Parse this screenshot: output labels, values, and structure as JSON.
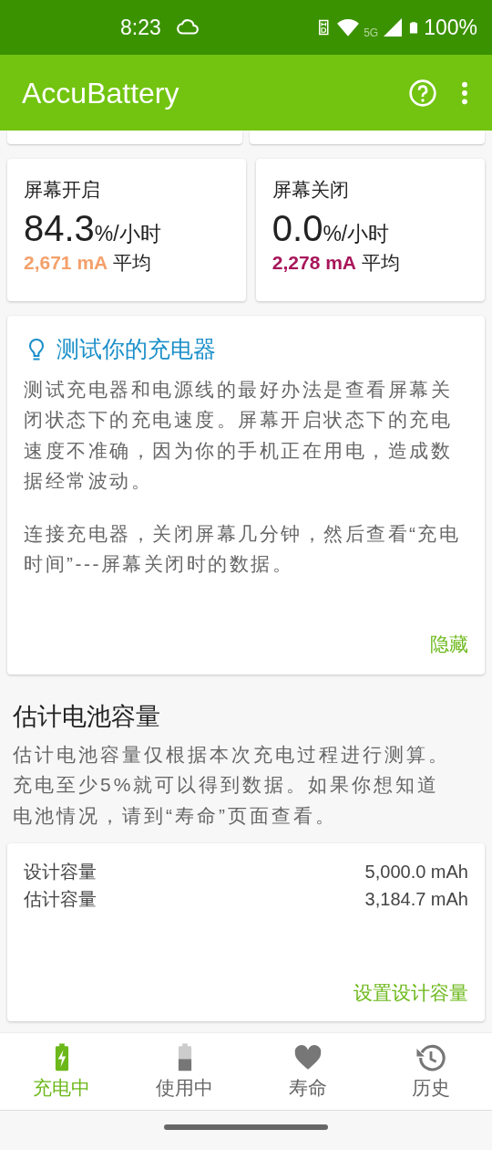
{
  "status_bar": {
    "time": "8:23",
    "network": "5G",
    "battery": "100%"
  },
  "app_bar": {
    "title": "AccuBattery"
  },
  "rate_cards": [
    {
      "title": "屏幕开启",
      "value": "84.3",
      "unit": "%/小时",
      "current": "2,671 mA",
      "suffix": "平均",
      "color": "#f4a06a"
    },
    {
      "title": "屏幕关闭",
      "value": "0.0",
      "unit": "%/小时",
      "current": "2,278 mA",
      "suffix": "平均",
      "color": "#a8165a"
    }
  ],
  "tip_card": {
    "title": "测试你的充电器",
    "paragraphs": [
      "测试充电器和电源线的最好办法是查看屏幕关闭状态下的充电速度。屏幕开启状态下的充电速度不准确，因为你的手机正在用电，造成数据经常波动。",
      "连接充电器，关闭屏幕几分钟，然后查看“充电时间”---屏幕关闭时的数据。"
    ],
    "action": "隐藏"
  },
  "capacity_section": {
    "title": "估计电池容量",
    "description": "估计电池容量仅根据本次充电过程进行测算。充电至少5%就可以得到数据。如果你想知道电池情况，请到“寿命”页面查看。"
  },
  "capacity_card": {
    "rows": [
      {
        "label": "设计容量",
        "value": "5,000.0 mAh"
      },
      {
        "label": "估计容量",
        "value": "3,184.7 mAh"
      }
    ],
    "action": "设置设计容量"
  },
  "bottom_nav": [
    {
      "label": "充电中",
      "selected": true
    },
    {
      "label": "使用中",
      "selected": false
    },
    {
      "label": "寿命",
      "selected": false
    },
    {
      "label": "历史",
      "selected": false
    }
  ]
}
